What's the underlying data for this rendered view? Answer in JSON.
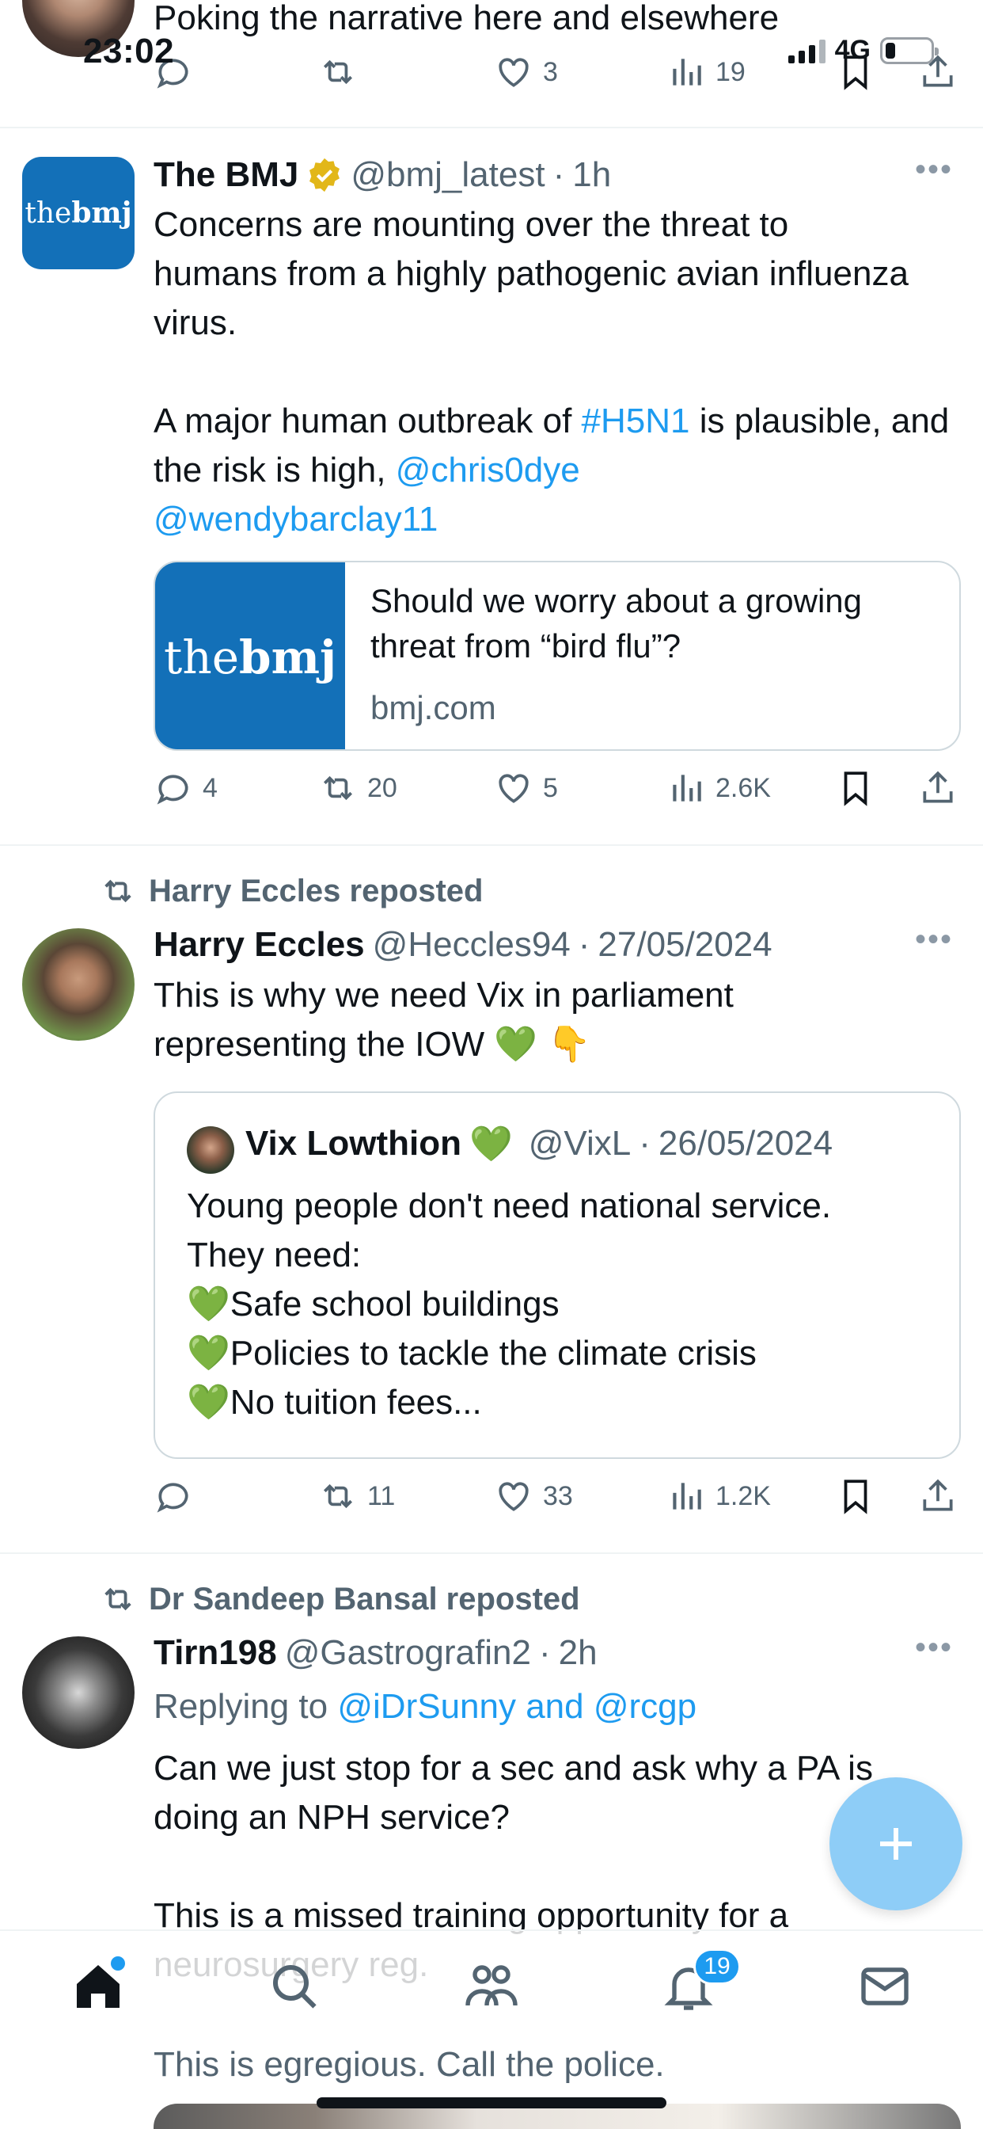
{
  "status_bar": {
    "time": "23:02",
    "network": "4G"
  },
  "top_tweet": {
    "text": "Poking the narrative here and elsewhere",
    "retweets": "",
    "likes": "3",
    "views": "19"
  },
  "tweet_bmj": {
    "name": "The BMJ",
    "handle": "@bmj_latest",
    "time": "1h",
    "text_p1": "Concerns are mounting over the threat to humans from a highly pathogenic avian influenza virus.",
    "text_p2_a": "A major human outbreak of ",
    "hashtag": "#H5N1",
    "text_p2_b": " is plausible, and the risk is high, ",
    "mention1": "@chris0dye",
    "mention2": "@wendybarclay11",
    "card": {
      "logo_the": "the",
      "logo_bmj": "bmj",
      "title": "Should we worry about a growing threat from “bird flu”?",
      "domain": "bmj.com"
    },
    "replies": "4",
    "retweets": "20",
    "likes": "5",
    "views": "2.6K",
    "avatar_the": "the",
    "avatar_bmj": "bmj"
  },
  "tweet_harry": {
    "repost_label": "Harry Eccles reposted",
    "name": "Harry Eccles",
    "handle": "@Heccles94",
    "time": "27/05/2024",
    "text_a": "This is why we need Vix in parliament representing the IOW ",
    "emoji1": "💚",
    "emoji2": "👇",
    "quote": {
      "name": "Vix Lowthion",
      "name_emoji": "💚",
      "handle": "@VixL",
      "time": "26/05/2024",
      "line1": "Young people don't need national service.",
      "line2": "They need:",
      "items": [
        {
          "emoji": "💚",
          "text": "Safe school buildings"
        },
        {
          "emoji": "💚",
          "text": "Policies to tackle the climate crisis"
        },
        {
          "emoji": "💚",
          "text": "No tuition fees..."
        }
      ]
    },
    "retweets": "11",
    "likes": "33",
    "views": "1.2K"
  },
  "tweet_tirn": {
    "repost_label": "Dr Sandeep Bansal reposted",
    "name": "Tirn198",
    "handle": "@Gastrografin2",
    "time": "2h",
    "replying_prefix": "Replying to ",
    "replying_to": "@iDrSunny and @rcgp",
    "text_p1": "Can we just stop for a sec and ask why a PA is doing an NPH service?",
    "text_p2": "This is a missed training opportunity for a neurosurgery reg.",
    "text_p3": "This is egregious. Call the police."
  },
  "nav": {
    "notifications_badge": "19"
  },
  "colors": {
    "accent": "#1d9bf0",
    "bmj_blue": "#1370b8",
    "muted": "#536471",
    "fab": "#8ecdf7"
  }
}
